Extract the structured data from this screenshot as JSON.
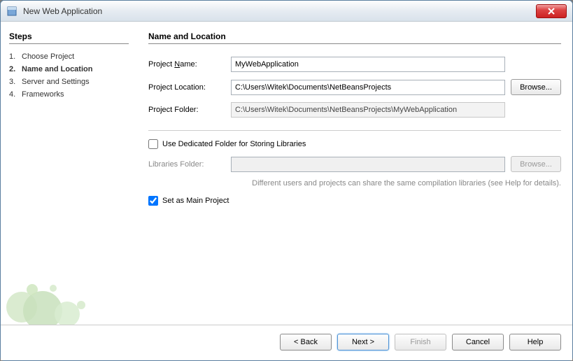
{
  "window": {
    "title": "New Web Application"
  },
  "sidebar": {
    "heading": "Steps",
    "steps": [
      {
        "num": "1.",
        "label": "Choose Project",
        "current": false
      },
      {
        "num": "2.",
        "label": "Name and Location",
        "current": true
      },
      {
        "num": "3.",
        "label": "Server and Settings",
        "current": false
      },
      {
        "num": "4.",
        "label": "Frameworks",
        "current": false
      }
    ]
  },
  "main": {
    "heading": "Name and Location",
    "projectName": {
      "label": "Project Name:",
      "value": "MyWebApplication"
    },
    "projectLocation": {
      "label": "Project Location:",
      "value": "C:\\Users\\Witek\\Documents\\NetBeansProjects",
      "browse": "Browse..."
    },
    "projectFolder": {
      "label": "Project Folder:",
      "value": "C:\\Users\\Witek\\Documents\\NetBeansProjects\\MyWebApplication"
    },
    "dedicatedFolder": {
      "label": "Use Dedicated Folder for Storing Libraries",
      "checked": false
    },
    "librariesFolder": {
      "label": "Libraries Folder:",
      "value": "",
      "browse": "Browse..."
    },
    "hint": "Different users and projects can share the same compilation libraries (see Help for details).",
    "setMain": {
      "label": "Set as Main Project",
      "checked": true
    }
  },
  "buttons": {
    "back": "< Back",
    "next": "Next >",
    "finish": "Finish",
    "cancel": "Cancel",
    "help": "Help"
  }
}
